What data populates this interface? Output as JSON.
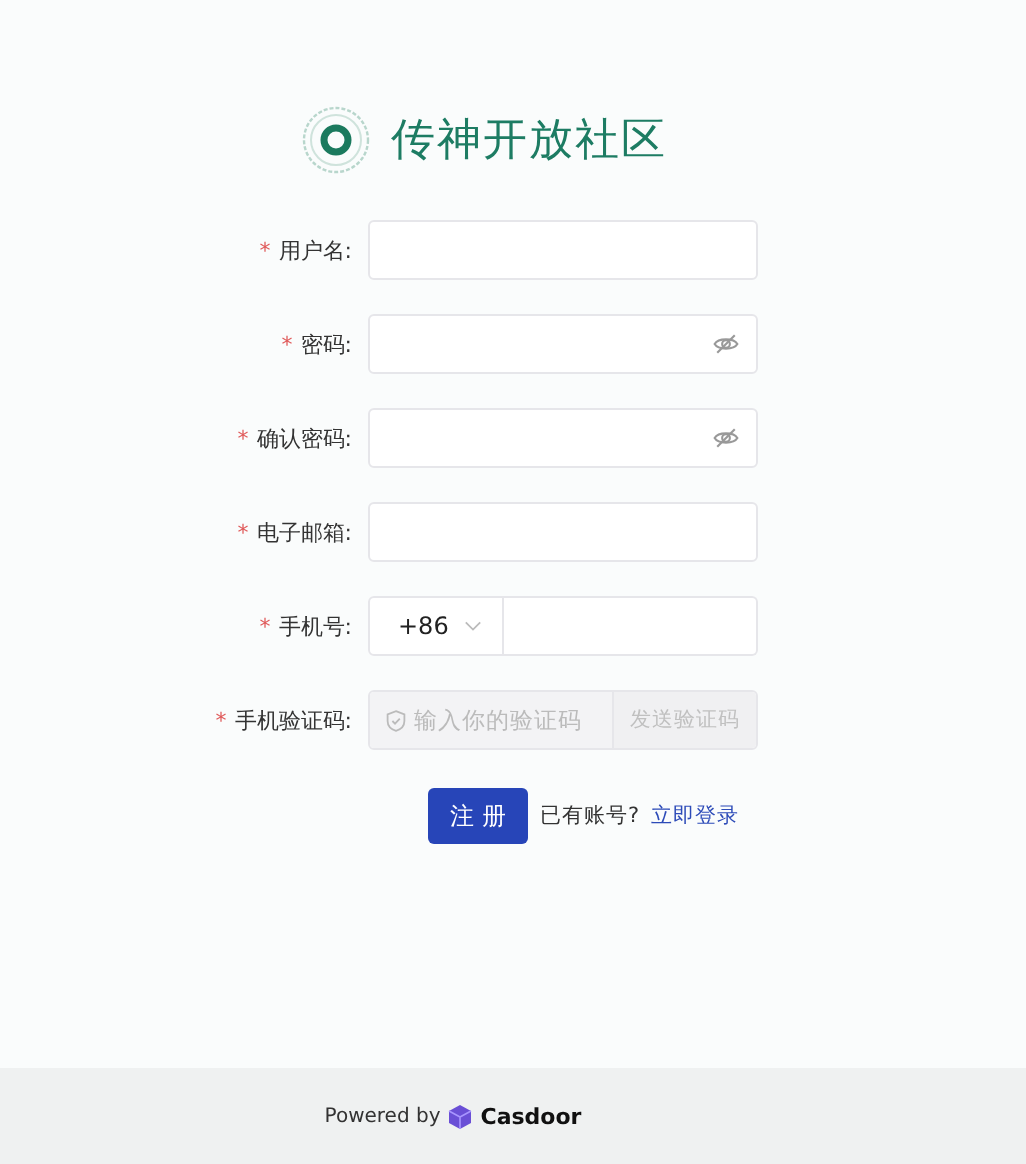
{
  "header": {
    "title": "传神开放社区"
  },
  "fields": [
    {
      "kind": "text",
      "mark": "*",
      "label": "用户名:"
    },
    {
      "kind": "password",
      "mark": "*",
      "label": "密码:"
    },
    {
      "kind": "password",
      "mark": "*",
      "label": "确认密码:"
    },
    {
      "kind": "text",
      "mark": "*",
      "label": "电子邮箱:"
    },
    {
      "kind": "phone",
      "mark": "*",
      "label": "手机号:",
      "country_code": "+86"
    },
    {
      "kind": "code",
      "mark": "*",
      "label": "手机验证码:",
      "placeholder": "输入你的验证码",
      "button": "发送验证码",
      "disabled": true
    }
  ],
  "actions": {
    "submit": "注 册",
    "prompt": "已有账号?",
    "login_link": "立即登录"
  },
  "footer": {
    "powered_by": "Powered by",
    "brand": "Casdoor"
  }
}
